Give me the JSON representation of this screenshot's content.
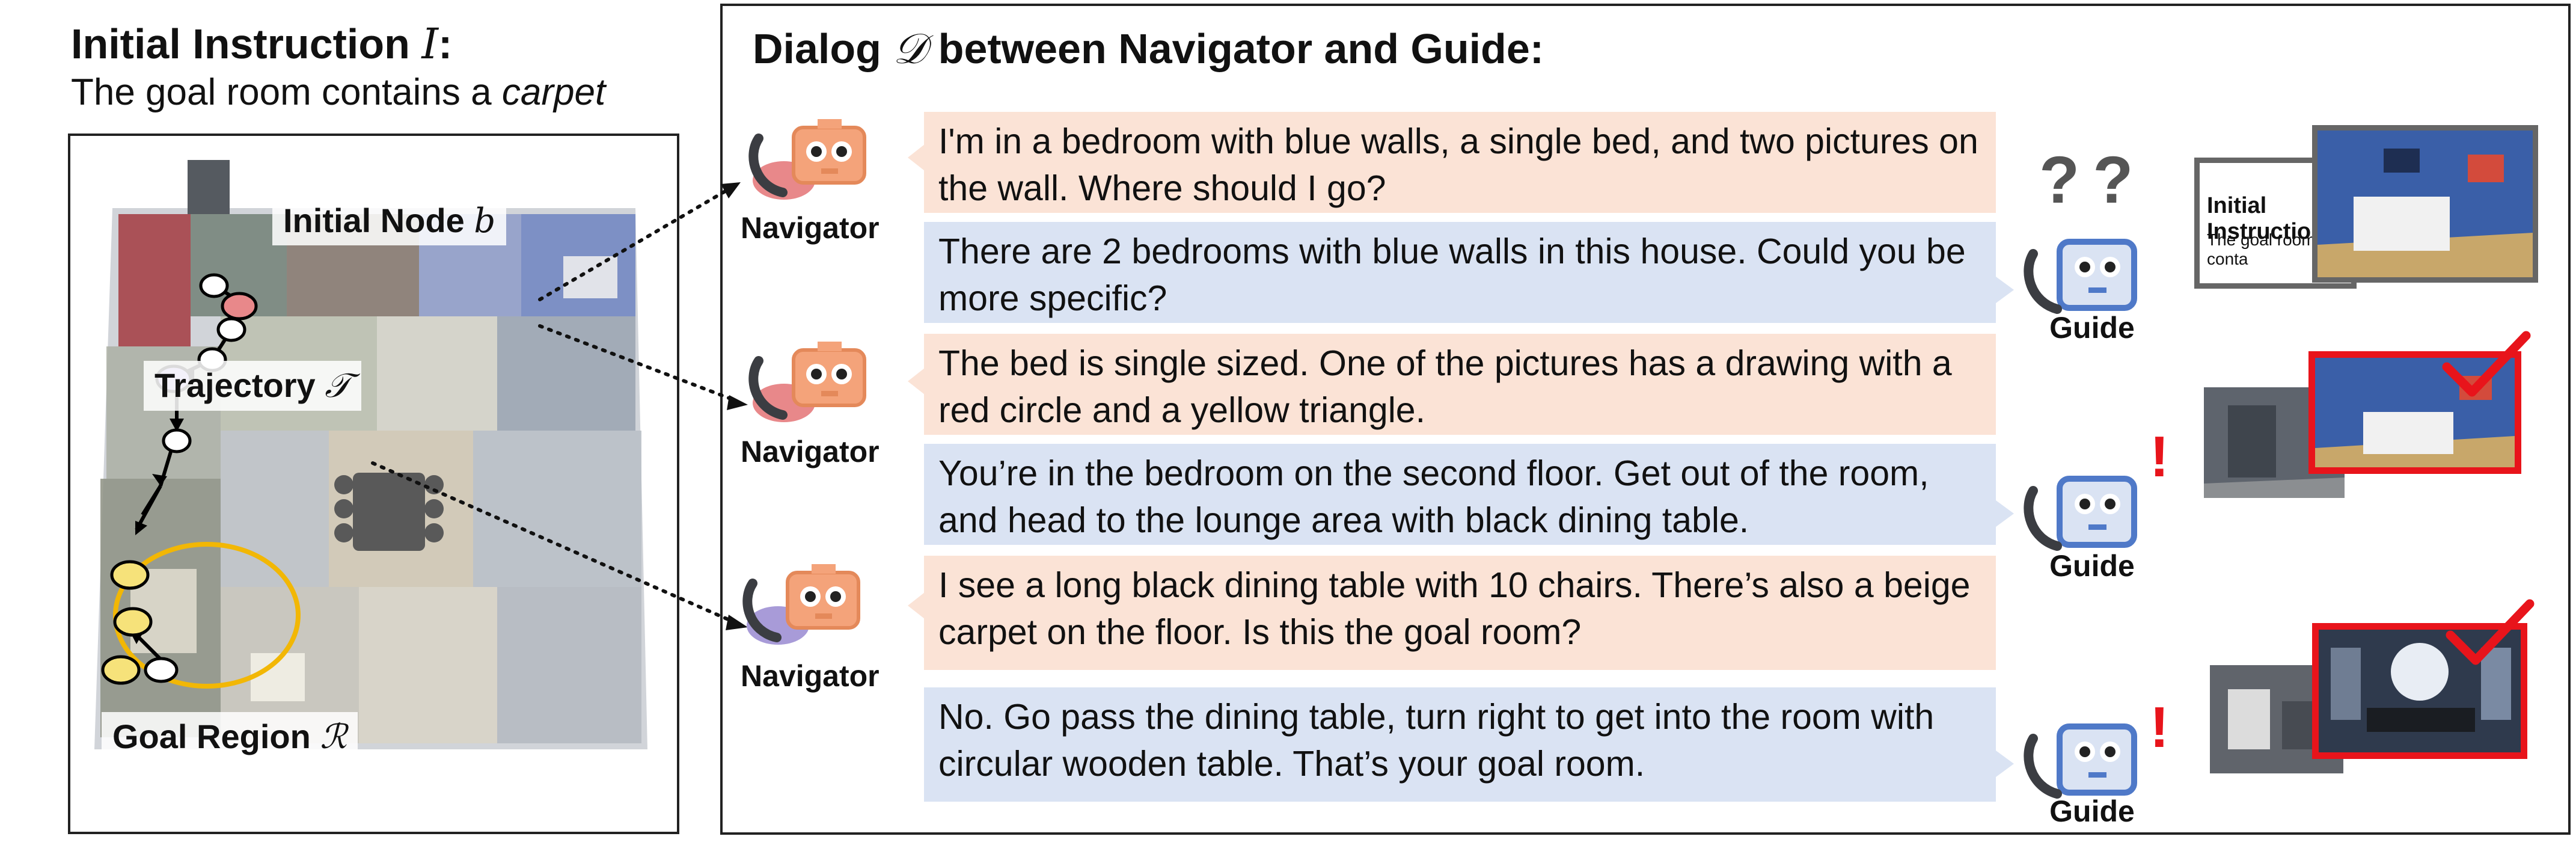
{
  "left": {
    "title_prefix": "Initial Instruction ",
    "title_symbol": "I",
    "title_suffix": ":",
    "instruction_prefix": "The goal room contains a ",
    "instruction_emph": "carpet",
    "labels": {
      "initial_node": "Initial Node ",
      "initial_node_symbol": "b",
      "trajectory": "Trajectory ",
      "trajectory_symbol": "𝒯",
      "goal_region": "Goal Region ",
      "goal_region_symbol": "ℛ"
    }
  },
  "right": {
    "title_prefix": "Dialog ",
    "title_symbol": "𝒟",
    "title_suffix": " between Navigator and Guide:",
    "navigator_label": "Navigator",
    "guide_label": "Guide",
    "turns": [
      {
        "nav": "I'm in a bedroom with blue walls, a single bed, and two pictures on the wall. Where should I go?",
        "guide": "There are 2 bedrooms with blue walls in this house. Could you be more specific?"
      },
      {
        "nav": "The bed is single sized. One of the pictures has a drawing with a red circle and a yellow triangle.",
        "guide": "You’re in the bedroom on the second floor. Get out of the room, and head to the lounge area with black dining table."
      },
      {
        "nav": "I see a long black dining table with 10 chairs. There’s also a beige carpet on the floor. Is this the goal room?",
        "guide": "No. Go pass the dining table, turn right to get into the room with circular wooden table. That’s your goal room."
      }
    ],
    "question_marks": "??",
    "exclamation": "!",
    "card_title": "Initial Instruction",
    "card_text": "The goal room conta"
  },
  "colors": {
    "navigator_bubble": "#fbe3d6",
    "guide_bubble": "#dae3f3",
    "navigator_icon": "#f4a37a",
    "guide_icon": "#4f79c8",
    "highlight_red": "#e8141b",
    "goal_ring": "#f2b705",
    "node_initial": "#e8888a",
    "node_current": "#a89bd8",
    "node_goal": "#f6e27a"
  }
}
